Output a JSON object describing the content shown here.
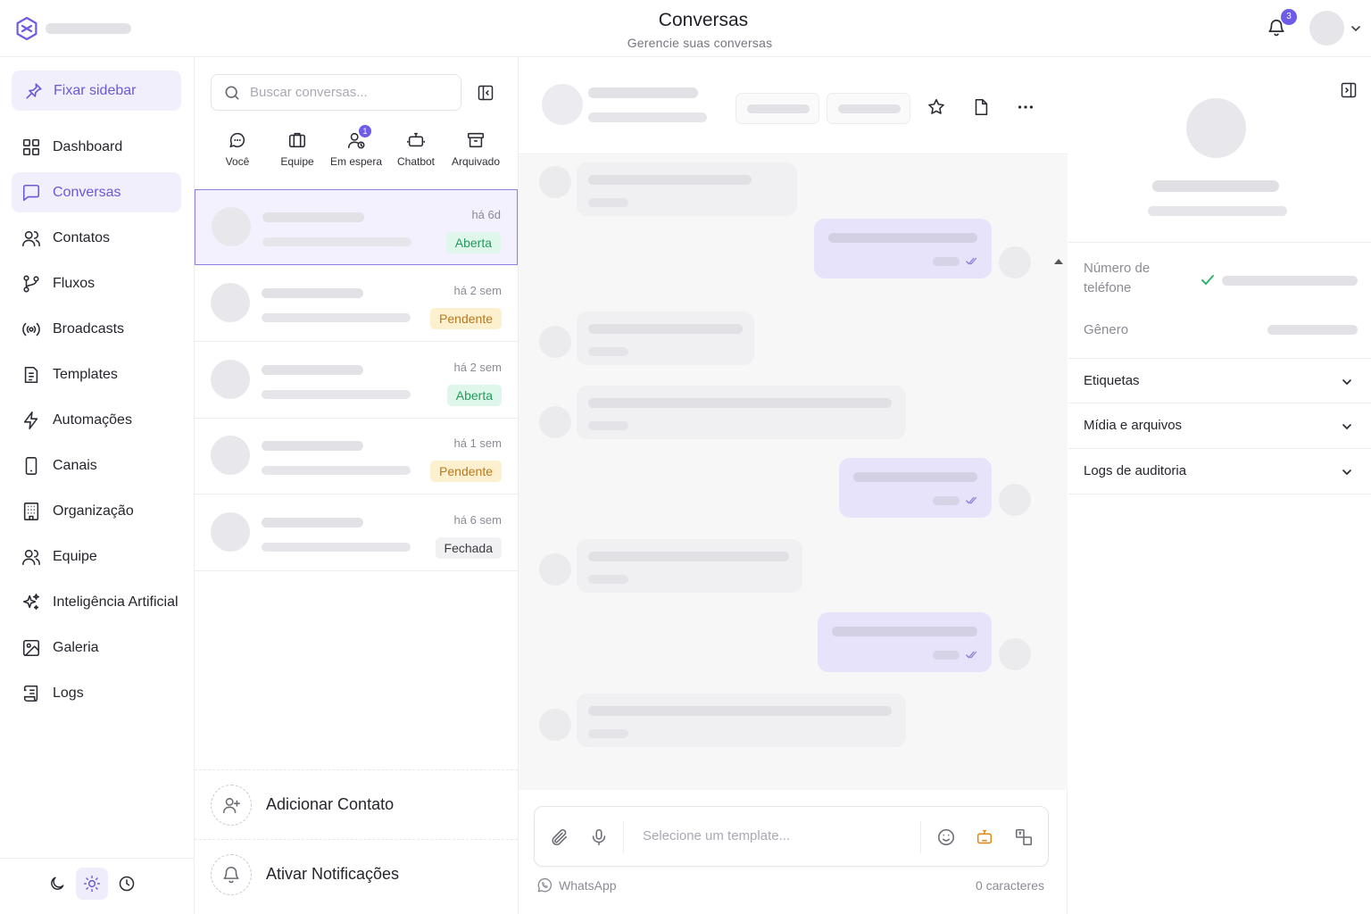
{
  "header": {
    "title": "Conversas",
    "subtitle": "Gerencie suas conversas",
    "notifications_count": "3"
  },
  "sidebar": {
    "pin_label": "Fixar sidebar",
    "items": [
      {
        "label": "Dashboard",
        "icon": "dashboard-icon"
      },
      {
        "label": "Conversas",
        "icon": "chat-icon",
        "active": true
      },
      {
        "label": "Contatos",
        "icon": "users-icon"
      },
      {
        "label": "Fluxos",
        "icon": "git-branch-icon"
      },
      {
        "label": "Broadcasts",
        "icon": "broadcast-icon"
      },
      {
        "label": "Templates",
        "icon": "document-icon"
      },
      {
        "label": "Automações",
        "icon": "lightning-icon"
      },
      {
        "label": "Canais",
        "icon": "phone-icon"
      },
      {
        "label": "Organização",
        "icon": "building-icon"
      },
      {
        "label": "Equipe",
        "icon": "team-icon"
      },
      {
        "label": "Inteligência Artificial",
        "icon": "sparkles-icon"
      },
      {
        "label": "Galeria",
        "icon": "image-icon"
      },
      {
        "label": "Logs",
        "icon": "scroll-icon"
      }
    ],
    "theme_buttons": [
      "moon-icon",
      "sun-icon",
      "clock-icon"
    ]
  },
  "list": {
    "search_placeholder": "Buscar conversas...",
    "tabs": [
      {
        "label": "Você",
        "icon": "chat-bubble-icon"
      },
      {
        "label": "Equipe",
        "icon": "briefcase-icon"
      },
      {
        "label": "Em espera",
        "icon": "user-wait-icon",
        "badge": "1"
      },
      {
        "label": "Chatbot",
        "icon": "robot-icon"
      },
      {
        "label": "Arquivado",
        "icon": "archive-icon"
      }
    ],
    "conversations": [
      {
        "time": "há 6d",
        "status": "Aberta",
        "selected": true
      },
      {
        "time": "há 2 sem",
        "status": "Pendente"
      },
      {
        "time": "há 2 sem",
        "status": "Aberta"
      },
      {
        "time": "há 1 sem",
        "status": "Pendente"
      },
      {
        "time": "há 6 sem",
        "status": "Fechada"
      }
    ],
    "add_contact_label": "Adicionar Contato",
    "enable_notifications_label": "Ativar Notificações"
  },
  "chat": {
    "composer_placeholder": "Selecione um template...",
    "channel_label": "WhatsApp",
    "char_count_label": "0 caracteres"
  },
  "details": {
    "phone_label": "Número de teléfone",
    "gender_label": "Gênero",
    "sections": [
      "Etiquetas",
      "Mídia e arquivos",
      "Logs de auditoria"
    ]
  },
  "colors": {
    "accent": "#6c5ce7",
    "accent_bg": "#f1effc",
    "open_bg": "#dff6ea",
    "open_text": "#239a5c",
    "pending_bg": "#fdf0cf",
    "pending_text": "#b7791f"
  }
}
